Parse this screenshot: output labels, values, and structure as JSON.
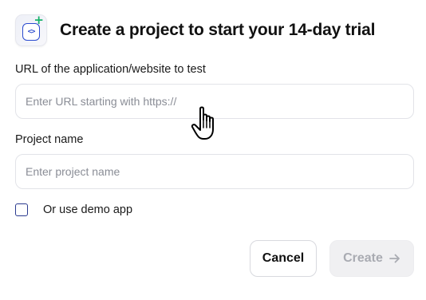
{
  "header": {
    "title": "Create a project to start your 14-day trial",
    "logo_icon": "code-brackets-plus-icon",
    "accent_color": "#2b4bcf",
    "plus_color": "#17b26a"
  },
  "url_field": {
    "label": "URL of the application/website to test",
    "value": "",
    "placeholder": "Enter URL starting with https://"
  },
  "project_field": {
    "label": "Project name",
    "value": "",
    "placeholder": "Enter project name"
  },
  "demo_option": {
    "label": "Or use demo app",
    "checked": false
  },
  "actions": {
    "cancel_label": "Cancel",
    "create_label": "Create",
    "create_icon": "arrow-right-icon",
    "create_disabled": true
  },
  "pointer": {
    "icon": "hand-pointer-cursor-icon"
  }
}
